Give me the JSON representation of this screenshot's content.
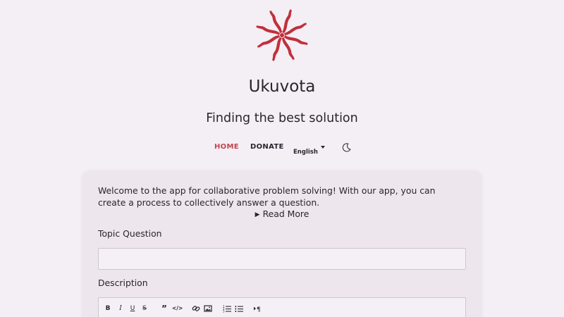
{
  "header": {
    "app_name": "Ukuvota",
    "tagline": "Finding the best solution",
    "logo_icon": "spiral-star-logo",
    "logo_color": "#c0303c"
  },
  "nav": {
    "home_label": "HOME",
    "donate_label": "DONATE",
    "language": "English",
    "active_color": "#c0454e",
    "theme_icon": "moon-icon"
  },
  "intro": {
    "welcome_text": "Welcome to the app for collaborative problem solving! With our app, you can create a process to collectively answer a question.",
    "read_more_label": "Read More"
  },
  "form": {
    "topic_label": "Topic Question",
    "topic_value": "",
    "description_label": "Description"
  },
  "editor_toolbar": {
    "bold": "B",
    "italic": "I",
    "underline": "U",
    "strike": "S",
    "blockquote": "”",
    "code": "</>",
    "link_icon": "link-icon",
    "image_icon": "image-icon",
    "ordered_list_icon": "ordered-list-icon",
    "bullet_list_icon": "bullet-list-icon",
    "paragraph_icon": "paragraph-icon"
  }
}
